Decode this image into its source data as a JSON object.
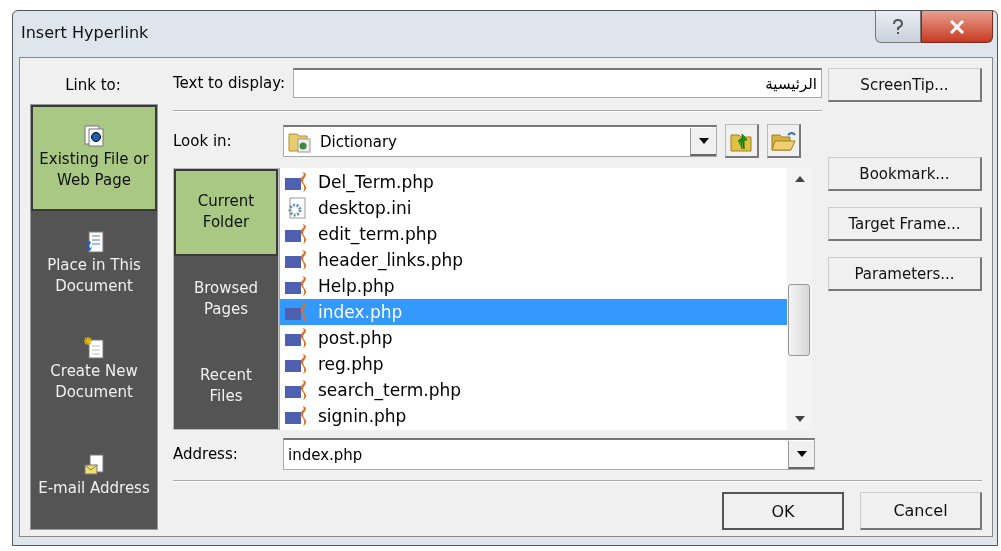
{
  "window": {
    "title": "Insert Hyperlink"
  },
  "link_to": {
    "label": "Link to:",
    "items": [
      {
        "kind": "file",
        "label": "Existing File or Web Page",
        "selected": true
      },
      {
        "kind": "place",
        "label": "Place in This Document",
        "selected": false
      },
      {
        "kind": "new",
        "label": "Create New Document",
        "selected": false
      },
      {
        "kind": "email",
        "label": "E-mail Address",
        "selected": false
      }
    ]
  },
  "text_to_display": {
    "label": "Text to display:",
    "value": "الرئيسية"
  },
  "look_in": {
    "label": "Look in:",
    "value": "Dictionary"
  },
  "folder_tabs": [
    {
      "label": "Current Folder",
      "selected": true
    },
    {
      "label": "Browsed Pages",
      "selected": false
    },
    {
      "label": "Recent Files",
      "selected": false
    }
  ],
  "files": [
    {
      "kind": "php",
      "name": "Del_Term.php",
      "selected": false
    },
    {
      "kind": "ini",
      "name": "desktop.ini",
      "selected": false
    },
    {
      "kind": "php",
      "name": "edit_term.php",
      "selected": false
    },
    {
      "kind": "php",
      "name": "header_links.php",
      "selected": false
    },
    {
      "kind": "php",
      "name": "Help.php",
      "selected": false
    },
    {
      "kind": "php",
      "name": "index.php",
      "selected": true
    },
    {
      "kind": "php",
      "name": "post.php",
      "selected": false
    },
    {
      "kind": "php",
      "name": "reg.php",
      "selected": false
    },
    {
      "kind": "php",
      "name": "search_term.php",
      "selected": false
    },
    {
      "kind": "php",
      "name": "signin.php",
      "selected": false
    }
  ],
  "address": {
    "label": "Address:",
    "value": "index.php"
  },
  "side_buttons": [
    "ScreenTip...",
    "Bookmark...",
    "Target Frame...",
    "Parameters..."
  ],
  "buttons": [
    "OK",
    "Cancel"
  ]
}
